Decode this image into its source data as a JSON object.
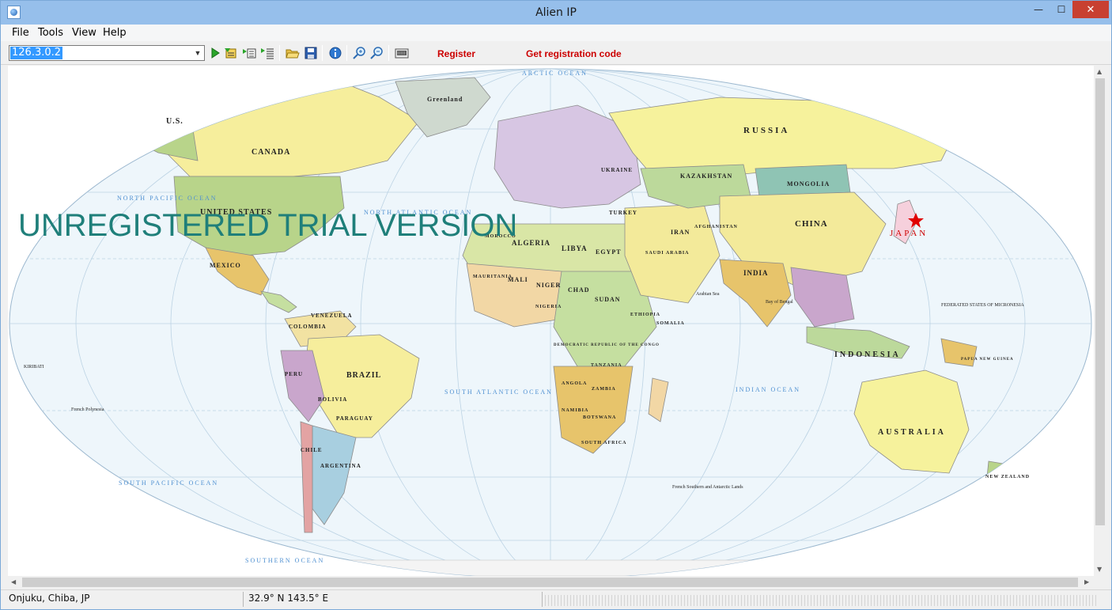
{
  "window": {
    "title": "Alien IP",
    "minimize_glyph": "—",
    "maximize_glyph": "☐",
    "close_glyph": "✕"
  },
  "menu": {
    "items": [
      {
        "label": "File"
      },
      {
        "label": "Tools"
      },
      {
        "label": "View"
      },
      {
        "label": "Help"
      }
    ]
  },
  "toolbar": {
    "ip_value": "126.3.0.2",
    "dropdown_glyph": "▼",
    "register_label": "Register",
    "get_code_label": "Get registration code",
    "buttons": [
      {
        "icon": "play-icon"
      },
      {
        "icon": "trace-icon"
      },
      {
        "icon": "list-icon"
      },
      {
        "icon": "multi-list-icon"
      },
      {
        "icon": "open-folder-icon"
      },
      {
        "icon": "save-icon"
      },
      {
        "icon": "info-icon"
      },
      {
        "icon": "zoom-in-icon"
      },
      {
        "icon": "zoom-out-icon"
      },
      {
        "icon": "keyboard-icon"
      }
    ]
  },
  "map": {
    "watermark": "UNREGISTERED TRIAL VERSION",
    "marker_label": "JAPAN",
    "countries": [
      "U.S.",
      "CANADA",
      "UNITED STATES",
      "MEXICO",
      "BRAZIL",
      "ARGENTINA",
      "BOLIVIA",
      "PERU",
      "COLOMBIA",
      "VENEZUELA",
      "CHILE",
      "PARAGUAY",
      "Greenland",
      "RUSSIA",
      "KAZAKHSTAN",
      "MONGOLIA",
      "CHINA",
      "INDIA",
      "IRAN",
      "AFGHANISTAN",
      "TURKEY",
      "UKRAINE",
      "ALGERIA",
      "LIBYA",
      "EGYPT",
      "MAURITANIA",
      "MALI",
      "NIGER",
      "CHAD",
      "SUDAN",
      "NIGERIA",
      "ETHIOPIA",
      "SOMALIA",
      "DEMOCRATIC REPUBLIC OF THE CONGO",
      "TANZANIA",
      "ANGOLA",
      "ZAMBIA",
      "NAMIBIA",
      "BOTSWANA",
      "SOUTH AFRICA",
      "SAUDI ARABIA",
      "INDONESIA",
      "AUSTRALIA",
      "NEW ZEALAND",
      "PAPUA NEW GUINEA",
      "MOROCCO"
    ],
    "oceans": [
      "NORTH PACIFIC OCEAN",
      "NORTH ATLANTIC OCEAN",
      "SOUTH ATLANTIC OCEAN",
      "SOUTH PACIFIC OCEAN",
      "INDIAN OCEAN",
      "SOUTHERN OCEAN",
      "ARCTIC OCEAN"
    ],
    "place_notes": [
      "French Polynesia",
      "KIRIBATI",
      "Arabian Sea",
      "Bay of Bengal",
      "FEDERATED STATES OF MICRONESIA",
      "French Southern and Antarctic Lands"
    ]
  },
  "status": {
    "location": "Onjuku, Chiba, JP",
    "coordinates": "32.9° N 143.5° E"
  },
  "colors": {
    "title_bar": "#96bfeb",
    "close_button": "#c84031",
    "link_red": "#cc0000",
    "watermark": "#1f7f7a",
    "ocean": "#eef6fb",
    "marker": "#e00000"
  }
}
